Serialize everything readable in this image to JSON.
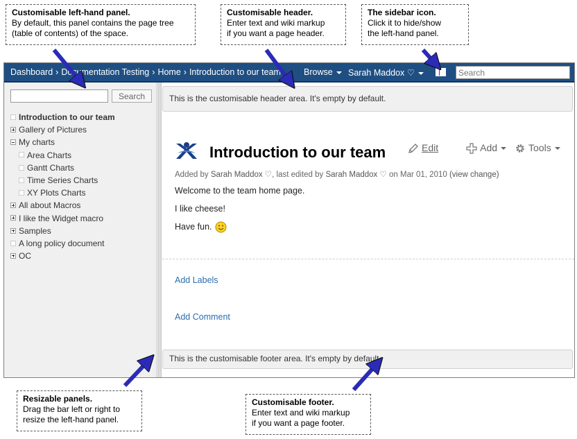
{
  "callouts": {
    "left_panel": {
      "title": "Customisable left-hand panel.",
      "body": "By default, this panel contains the page tree\n(table of contents) of the space."
    },
    "header": {
      "title": "Customisable header.",
      "body": "Enter text and wiki markup\nif you want a page header."
    },
    "sidebar_icon": {
      "title": "The sidebar icon.",
      "body": "Click it to hide/show\nthe left-hand panel."
    },
    "resizable": {
      "title": "Resizable panels.",
      "body": "Drag the bar left or right to\nresize the left-hand panel."
    },
    "footer": {
      "title": "Customisable footer.",
      "body": "Enter text and wiki markup\nif you want a page footer."
    }
  },
  "topbar": {
    "breadcrumbs": [
      "Dashboard",
      "Documentation Testing",
      "Home",
      "Introduction to our team"
    ],
    "separator": "›",
    "browse_label": "Browse",
    "user_label": "Sarah Maddox ♡",
    "search_placeholder": "Search",
    "colors": {
      "bar": "#1f4f82"
    }
  },
  "left_panel": {
    "search_placeholder": "",
    "search_button": "Search",
    "tree": [
      {
        "label": "Introduction to our team",
        "node": "leaf",
        "current": true,
        "level": 0
      },
      {
        "label": "Gallery of Pictures",
        "node": "plus",
        "level": 0
      },
      {
        "label": "My charts",
        "node": "minus",
        "level": 0
      },
      {
        "label": "Area Charts",
        "node": "leaf",
        "level": 1
      },
      {
        "label": "Gantt Charts",
        "node": "leaf",
        "level": 1
      },
      {
        "label": "Time Series Charts",
        "node": "leaf",
        "level": 1
      },
      {
        "label": "XY Plots Charts",
        "node": "leaf",
        "level": 1
      },
      {
        "label": "All about Macros",
        "node": "plus",
        "level": 0
      },
      {
        "label": "I like the Widget macro",
        "node": "plus",
        "level": 0
      },
      {
        "label": "Samples",
        "node": "plus",
        "level": 0
      },
      {
        "label": "A long policy document",
        "node": "leaf",
        "level": 0
      },
      {
        "label": "OC",
        "node": "plus",
        "level": 0
      }
    ]
  },
  "content": {
    "header_text": "This is the customisable header area. It's empty by default.",
    "title": "Introduction to our team",
    "meta": {
      "added_by_prefix": "Added by",
      "added_by": "Sarah Maddox ♡",
      "edited_prefix": ", last edited by",
      "edited_by": "Sarah Maddox ♡",
      "date": "on Mar 01, 2010",
      "view_change": "(view change)"
    },
    "actions": {
      "edit": "Edit",
      "add": "Add",
      "tools": "Tools"
    },
    "body": [
      "Welcome to the team home page.",
      "I like cheese!",
      "Have fun."
    ],
    "add_labels": "Add Labels",
    "add_comment": "Add Comment",
    "footer_text": "This is the customisable footer area. It's empty by default."
  },
  "icons": {
    "logo": "space-logo-icon",
    "edit": "pencil-icon",
    "add": "plus-icon",
    "tools": "gear-icon",
    "smiley": "smiley-icon",
    "sidebar": "sidebar-toggle-icon"
  },
  "annotation_color": "#2b2bb8"
}
